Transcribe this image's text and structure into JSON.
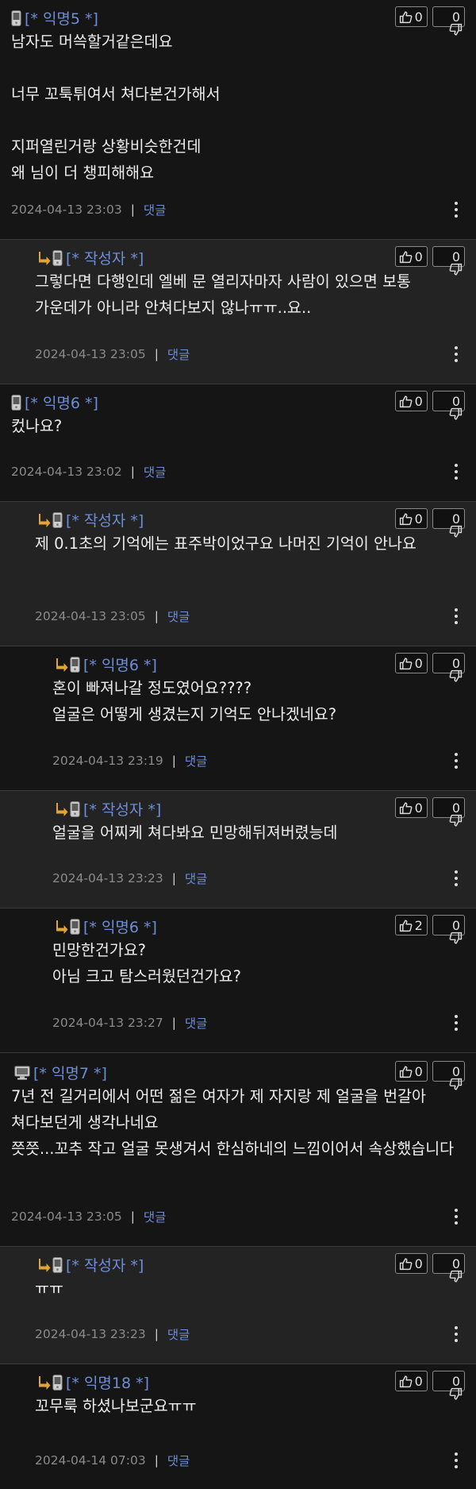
{
  "comments": [
    {
      "author": "[* 익명5 *]",
      "reply": false,
      "icon": "mobile",
      "up": "0",
      "down": "0",
      "lines": [
        "남자도 머쓱할거같은데요",
        "",
        "너무 꼬툭튀여서 쳐다본건가해서",
        "",
        "지퍼열린거랑 상황비슷한건데",
        "왜 님이 더 챙피해해요"
      ],
      "date": "2024-04-13 23:03",
      "reply_label": "댓글"
    },
    {
      "author": "[* 작성자 *]",
      "reply": true,
      "icon": "mobile",
      "up": "0",
      "down": "0",
      "lines": [
        "그렇다면 다행인데 엘베 문 열리자마자 사람이 있으면 보통 가운데가 아니라 안쳐다보지 않나ㅠㅠ..요.."
      ],
      "date": "2024-04-13 23:05",
      "reply_label": "댓글"
    },
    {
      "author": "[* 익명6 *]",
      "reply": false,
      "icon": "mobile",
      "up": "0",
      "down": "0",
      "lines": [
        "컸나요?"
      ],
      "date": "2024-04-13 23:02",
      "reply_label": "댓글"
    },
    {
      "author": "[* 작성자 *]",
      "reply": true,
      "icon": "mobile",
      "up": "0",
      "down": "0",
      "lines": [
        "제 0.1초의 기억에는 표주박이었구요 나머진 기억이 안나요"
      ],
      "date": "2024-04-13 23:05",
      "reply_label": "댓글"
    },
    {
      "author": "[* 익명6 *]",
      "reply": true,
      "icon": "mobile",
      "up": "0",
      "down": "0",
      "lines": [
        "혼이 빠져나갈 정도였어요????",
        "얼굴은 어떻게 생겼는지 기억도 안나겠네요?"
      ],
      "date": "2024-04-13 23:19",
      "reply_label": "댓글"
    },
    {
      "author": "[* 작성자 *]",
      "reply": true,
      "icon": "mobile",
      "up": "0",
      "down": "0",
      "lines": [
        "얼굴을 어찌케 쳐다봐요 민망해뒤져버렸능데"
      ],
      "date": "2024-04-13 23:23",
      "reply_label": "댓글"
    },
    {
      "author": "[* 익명6 *]",
      "reply": true,
      "icon": "mobile",
      "up": "2",
      "down": "0",
      "lines": [
        "민망한건가요?",
        "아님 크고 탐스러웠던건가요?"
      ],
      "date": "2024-04-13 23:27",
      "reply_label": "댓글"
    },
    {
      "author": "[* 익명7 *]",
      "reply": false,
      "icon": "pc",
      "up": "0",
      "down": "0",
      "lines": [
        "7년 전 길거리에서 어떤 젊은 여자가 제 자지랑 제 얼굴을 번갈아 쳐다보던게 생각나네요",
        "쯧쯧...꼬추 작고 얼굴 못생겨서 한심하네의 느낌이어서 속상했습니다"
      ],
      "date": "2024-04-13 23:05",
      "reply_label": "댓글"
    },
    {
      "author": "[* 작성자 *]",
      "reply": true,
      "icon": "mobile",
      "up": "0",
      "down": "0",
      "lines": [
        "ㅠㅠ"
      ],
      "date": "2024-04-13 23:23",
      "reply_label": "댓글"
    },
    {
      "author": "[* 익명18 *]",
      "reply": true,
      "icon": "mobile",
      "up": "0",
      "down": "0",
      "lines": [
        "꼬무룩 하셨나보군요ㅠㅠ"
      ],
      "date": "2024-04-14 07:03",
      "reply_label": "댓글"
    }
  ]
}
